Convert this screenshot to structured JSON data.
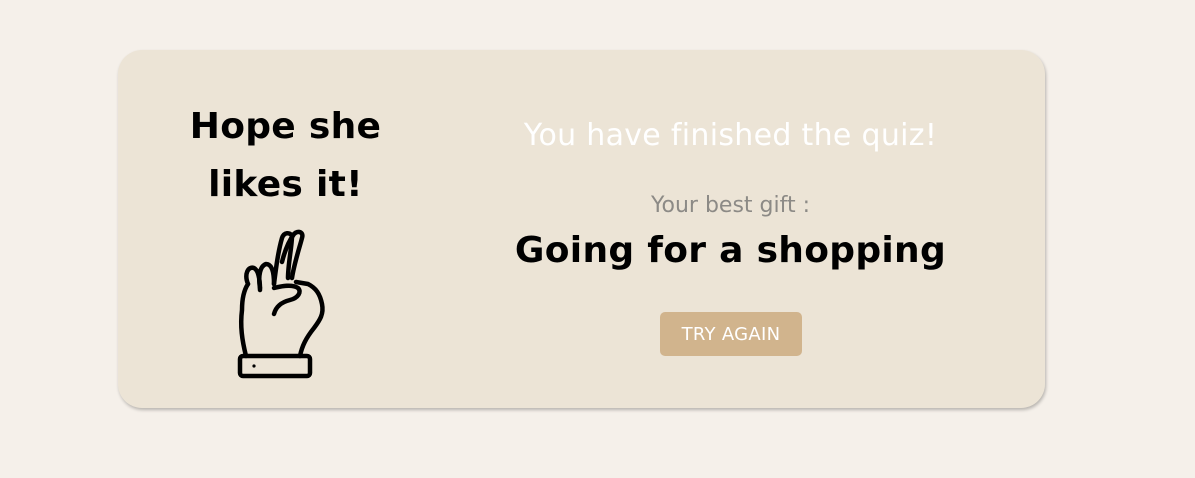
{
  "result_card": {
    "left_title_line1": "Hope she",
    "left_title_line2": "likes it!",
    "icon": "crossed-fingers-icon",
    "finished_message": "You have finished the quiz!",
    "best_gift_label": "Your best gift :",
    "best_gift_value": "Going for a shopping",
    "try_again_label": "TRY AGAIN"
  },
  "colors": {
    "page_background": "#f5f0ea",
    "card_background": "#ece4d6",
    "button_background": "#d1b48d",
    "finished_text": "#ffffff",
    "label_text": "#8c8a86"
  }
}
